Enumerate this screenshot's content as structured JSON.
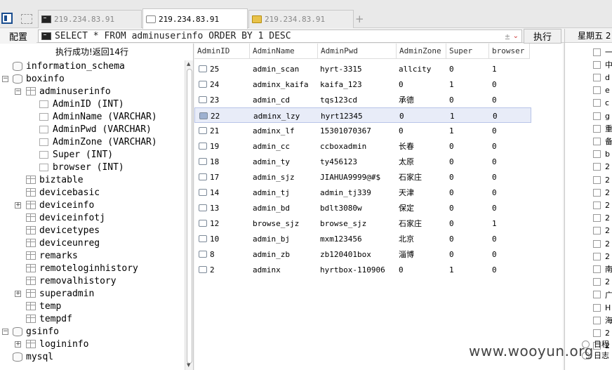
{
  "tabs": [
    {
      "label": "219.234.83.91",
      "icon": "terminal-icon",
      "active": false
    },
    {
      "label": "219.234.83.91",
      "icon": "window-icon",
      "active": true
    },
    {
      "label": "219.234.83.91",
      "icon": "folder-icon",
      "active": false
    }
  ],
  "new_tab": "+",
  "toolbar": {
    "config_label": "配置",
    "sql": "SELECT * FROM adminuserinfo ORDER BY 1 DESC",
    "dropdown_symbol": "±",
    "execute_label": "执行"
  },
  "status": "执行成功!返回14行",
  "tree": [
    {
      "label": "information_schema",
      "type": "db"
    },
    {
      "label": "boxinfo",
      "type": "db",
      "toggle": "⊟"
    },
    {
      "label": "adminuserinfo",
      "type": "table",
      "toggle": "⊟"
    },
    {
      "label": "AdminID (INT)",
      "type": "col"
    },
    {
      "label": "AdminName (VARCHAR)",
      "type": "col"
    },
    {
      "label": "AdminPwd (VARCHAR)",
      "type": "col"
    },
    {
      "label": "AdminZone (VARCHAR)",
      "type": "col"
    },
    {
      "label": "Super (INT)",
      "type": "col"
    },
    {
      "label": "browser (INT)",
      "type": "col"
    },
    {
      "label": "biztable",
      "type": "table"
    },
    {
      "label": "devicebasic",
      "type": "table"
    },
    {
      "label": "deviceinfo",
      "type": "table",
      "toggle": "⊞"
    },
    {
      "label": "deviceinfotj",
      "type": "table"
    },
    {
      "label": "devicetypes",
      "type": "table"
    },
    {
      "label": "deviceunreg",
      "type": "table"
    },
    {
      "label": "remarks",
      "type": "table"
    },
    {
      "label": "remoteloginhistory",
      "type": "table"
    },
    {
      "label": "removalhistory",
      "type": "table"
    },
    {
      "label": "superadmin",
      "type": "table",
      "toggle": "⊞"
    },
    {
      "label": "temp",
      "type": "table"
    },
    {
      "label": "tempdf",
      "type": "table"
    },
    {
      "label": "gsinfo",
      "type": "db",
      "toggle": "⊟"
    },
    {
      "label": "logininfo",
      "type": "table",
      "toggle": "⊞"
    },
    {
      "label": "mysql",
      "type": "db"
    }
  ],
  "grid": {
    "columns": [
      "AdminID",
      "AdminName",
      "AdminPwd",
      "AdminZone",
      "Super",
      "browser"
    ],
    "selected_row": 3,
    "rows": [
      [
        "25",
        "admin_scan",
        "hyrt-3315",
        "allcity",
        "0",
        "1"
      ],
      [
        "24",
        "adminx_kaifa",
        "kaifa_123",
        "0",
        "1",
        "0"
      ],
      [
        "23",
        "admin_cd",
        "tqs123cd",
        "承德",
        "0",
        "0"
      ],
      [
        "22",
        "adminx_lzy",
        "hyrt12345",
        "0",
        "1",
        "0"
      ],
      [
        "21",
        "adminx_lf",
        "15301070367",
        "0",
        "1",
        "0"
      ],
      [
        "19",
        "admin_cc",
        "ccboxadmin",
        "长春",
        "0",
        "0"
      ],
      [
        "18",
        "admin_ty",
        "ty456123",
        "太原",
        "0",
        "0"
      ],
      [
        "17",
        "admin_sjz",
        "JIAHUA9999@#$",
        "石家庄",
        "0",
        "0"
      ],
      [
        "14",
        "admin_tj",
        "admin_tj339",
        "天津",
        "0",
        "0"
      ],
      [
        "13",
        "admin_bd",
        "bdlt3080w",
        "保定",
        "0",
        "0"
      ],
      [
        "12",
        "browse_sjz",
        "browse_sjz",
        "石家庄",
        "0",
        "1"
      ],
      [
        "10",
        "admin_bj",
        "mxm123456",
        "北京",
        "0",
        "0"
      ],
      [
        "8",
        "admin_zb",
        "zb120401box",
        "淄博",
        "0",
        "0"
      ],
      [
        "2",
        "adminx",
        "hyrtbox-110906",
        "0",
        "1",
        "0"
      ]
    ]
  },
  "right_panel": {
    "weekday": "星期五 2",
    "items": [
      "一",
      "中",
      "d",
      "e",
      "c",
      "g",
      "重",
      "备",
      "b",
      "2",
      "2",
      "2",
      "2",
      "2",
      "2",
      "2",
      "2",
      "南",
      "2",
      "广",
      "H",
      "海",
      "2",
      "2"
    ],
    "footer": [
      "日程",
      "日志"
    ]
  },
  "watermark": "www.wooyun.org"
}
